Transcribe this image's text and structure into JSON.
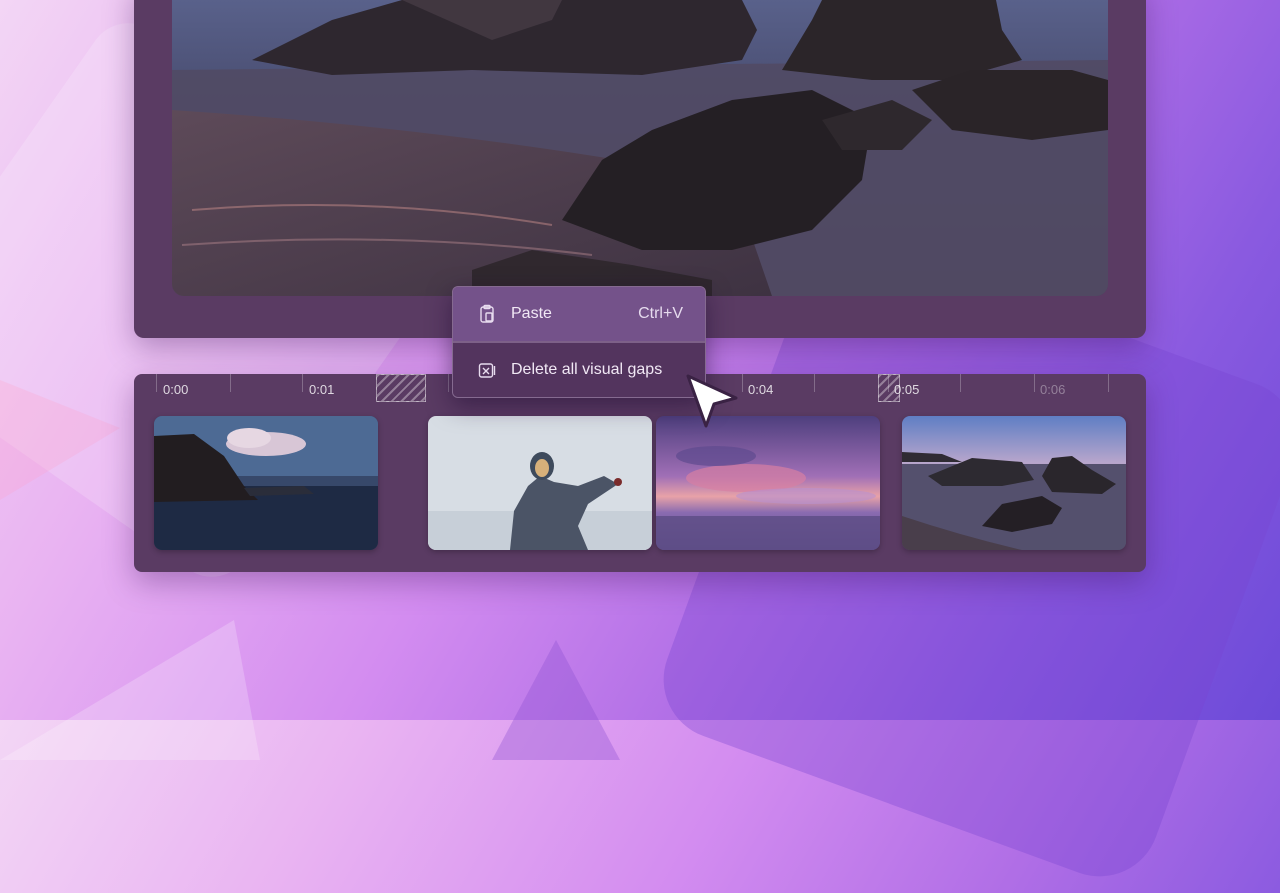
{
  "timeline": {
    "ticks": [
      "0:00",
      "0:01",
      "0:04",
      "0:05",
      "0:06"
    ]
  },
  "context_menu": {
    "items": [
      {
        "label": "Paste",
        "shortcut": "Ctrl+V",
        "icon": "clipboard-icon"
      },
      {
        "label": "Delete all visual gaps",
        "icon": "delete-gap-icon"
      }
    ]
  },
  "clips": [
    {
      "icon": "cliff-seascape-thumbnail"
    },
    {
      "icon": "person-in-poncho-thumbnail"
    },
    {
      "icon": "purple-sunset-thumbnail"
    },
    {
      "icon": "rocky-beach-thumbnail"
    }
  ],
  "colors": {
    "panel": "#5a3b63",
    "menu_bg": "#6b4a78",
    "menu_hover": "#74528a",
    "accent_background": "#b06ee6"
  }
}
